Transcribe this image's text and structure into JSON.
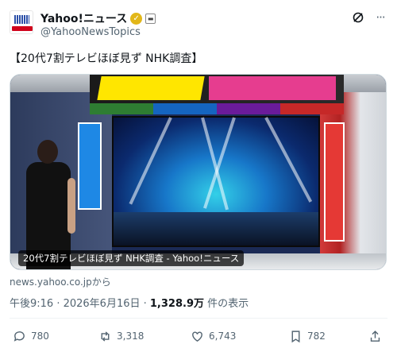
{
  "account": {
    "display_name": "Yahoo!ニュース",
    "handle": "@YahooNewsTopics",
    "verified_badge_color": "#e2b719"
  },
  "tweet": {
    "text": "【20代7割テレビほぼ見ず NHK調査】"
  },
  "card": {
    "caption": "20代7割テレビほぼ見ず NHK調査 - Yahoo!ニュース",
    "source": "news.yahoo.co.jpから"
  },
  "meta": {
    "timestamp": "午後9:16 · 2026年6月16日 · ",
    "views": "1,328.9万",
    "views_suffix": " 件の表示"
  },
  "actions": {
    "replies": "780",
    "reposts": "3,318",
    "likes": "6,743",
    "bookmarks": "782"
  },
  "icons": {
    "grok": "grok-icon",
    "more": "more-icon",
    "reply": "reply-icon",
    "repost": "repost-icon",
    "like": "heart-icon",
    "bookmark": "bookmark-icon",
    "share": "share-icon"
  }
}
